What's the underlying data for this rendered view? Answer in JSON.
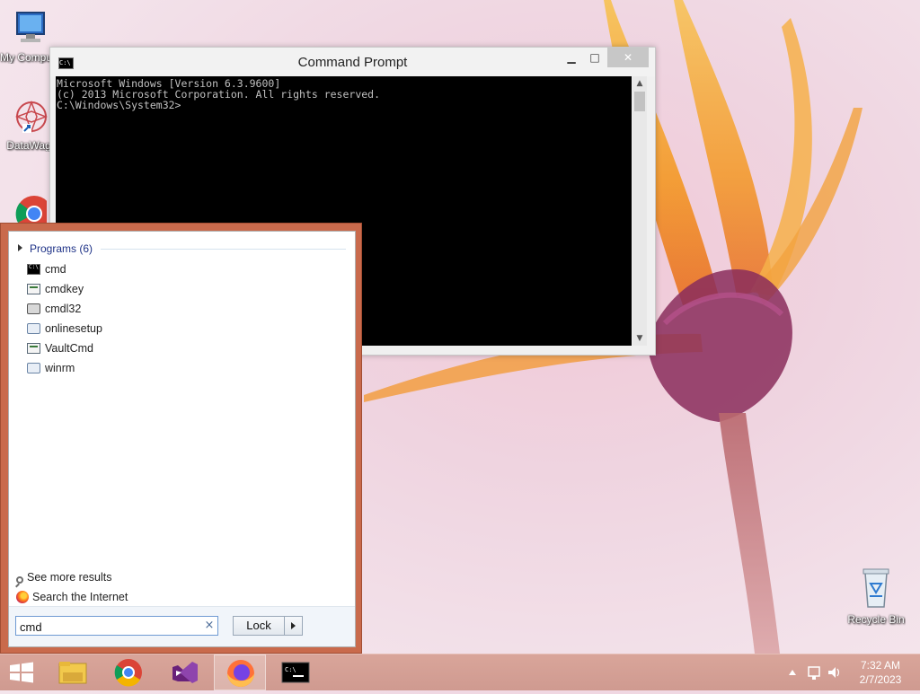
{
  "desktop": {
    "icons": [
      {
        "label": "My Computer",
        "icon": "computer-icon"
      },
      {
        "label": "DataWag",
        "icon": "datawag-icon"
      },
      {
        "label": "",
        "icon": "chrome-icon"
      },
      {
        "label": "Recycle Bin",
        "icon": "recycle-bin-icon"
      }
    ]
  },
  "cmd_window": {
    "title": "Command Prompt",
    "console_lines": [
      "Microsoft Windows [Version 6.3.9600]",
      "(c) 2013 Microsoft Corporation. All rights reserved.",
      "",
      "C:\\Windows\\System32>"
    ],
    "buttons": {
      "minimize": "▁",
      "maximize": "□",
      "close": "✕"
    }
  },
  "start_search": {
    "section_label": "Programs (6)",
    "results": [
      {
        "label": "cmd",
        "icon": "cmd-icon"
      },
      {
        "label": "cmdkey",
        "icon": "app-icon"
      },
      {
        "label": "cmdl32",
        "icon": "gear-app-icon"
      },
      {
        "label": "onlinesetup",
        "icon": "setup-icon"
      },
      {
        "label": "VaultCmd",
        "icon": "app-icon"
      },
      {
        "label": "winrm",
        "icon": "setup-icon"
      }
    ],
    "see_more": "See more results",
    "search_internet": "Search the Internet",
    "query": "cmd",
    "clear_symbol": "×",
    "lock_label": "Lock"
  },
  "taskbar": {
    "items": [
      "start-button",
      "file-explorer",
      "chrome",
      "visual-studio",
      "firefox",
      "command-prompt"
    ],
    "active_item": "firefox",
    "clock_time": "7:32 AM",
    "clock_date": "2/7/2023"
  }
}
